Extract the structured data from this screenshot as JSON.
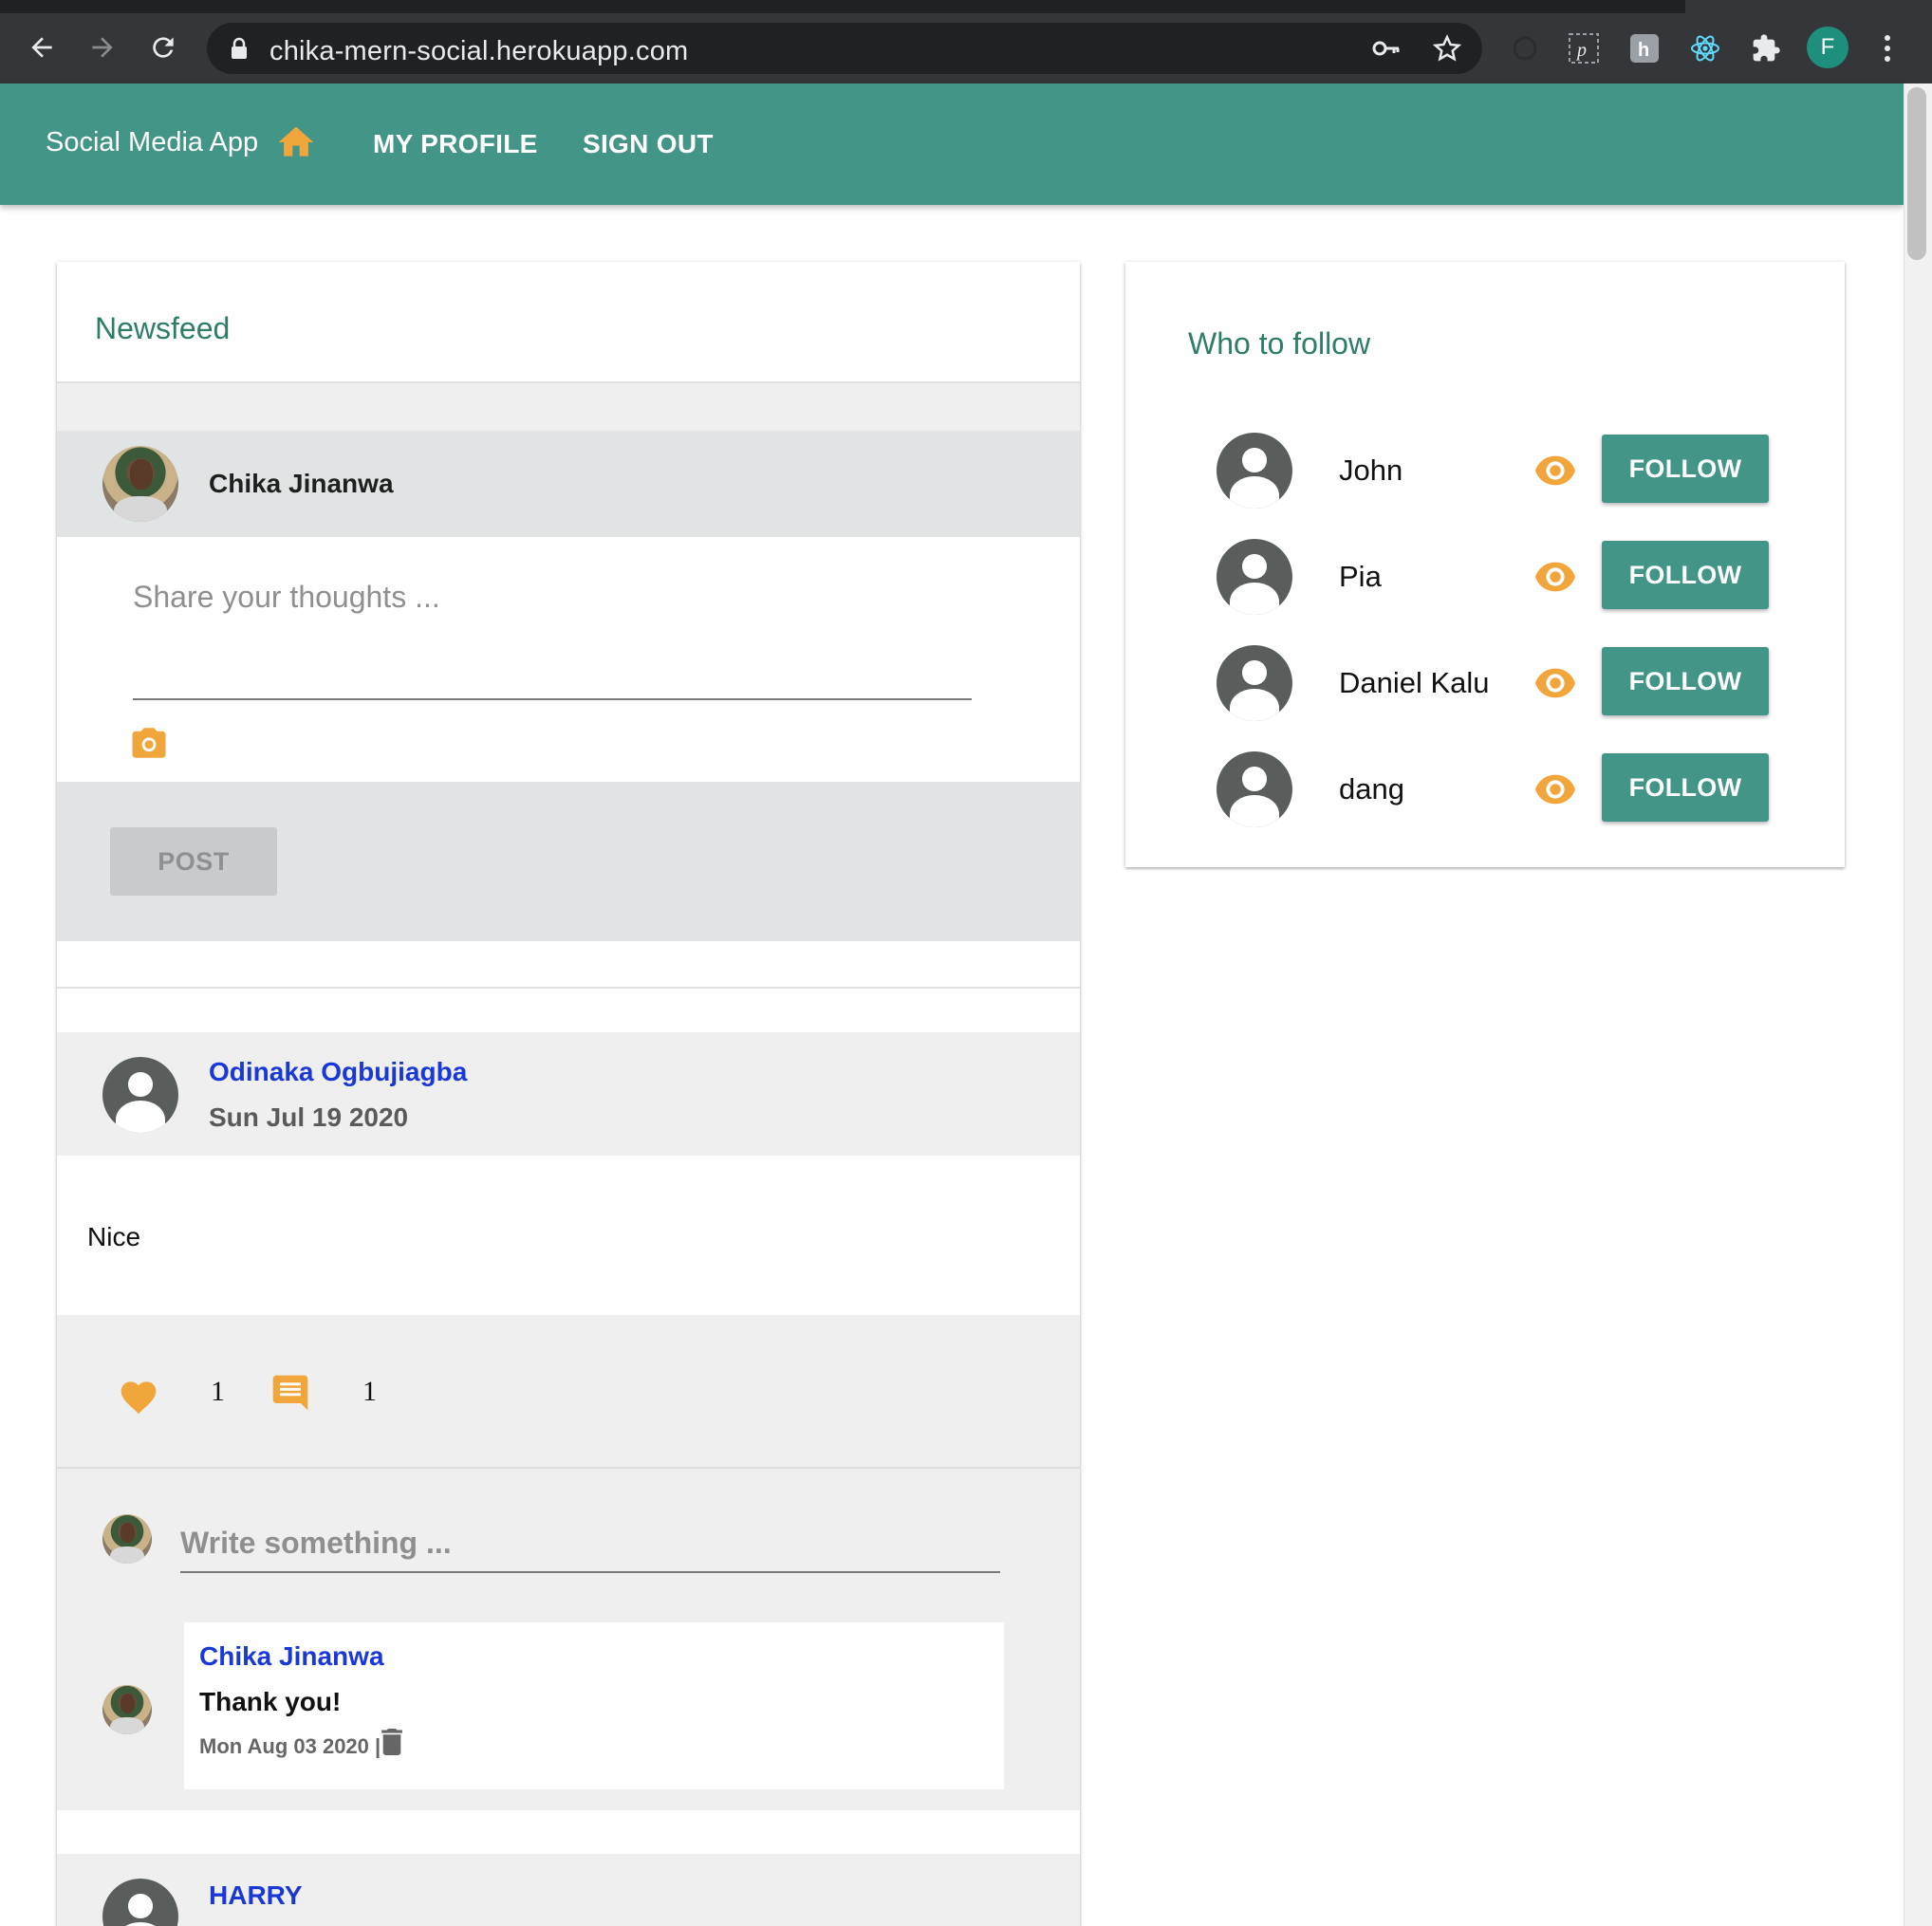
{
  "browser": {
    "url": "chika-mern-social.herokuapp.com",
    "profile_initial": "F"
  },
  "appbar": {
    "title": "Social Media App",
    "nav": [
      "MY PROFILE",
      "SIGN OUT"
    ]
  },
  "newsfeed": {
    "title": "Newsfeed",
    "new_post": {
      "user_name": "Chika Jinanwa",
      "placeholder": "Share your thoughts ...",
      "post_label": "POST"
    },
    "posts": [
      {
        "author": "Odinaka Ogbujiagba",
        "date": "Sun Jul 19 2020",
        "text": "Nice",
        "likes": "1",
        "comments_count": "1",
        "comment_placeholder": "Write something ...",
        "comments": [
          {
            "author": "Chika Jinanwa",
            "text": "Thank you!",
            "date": "Mon Aug 03 2020 |"
          }
        ]
      },
      {
        "author": "HARRY"
      }
    ]
  },
  "who_to_follow": {
    "title": "Who to follow",
    "users": [
      {
        "name": "John",
        "button": "FOLLOW"
      },
      {
        "name": "Pia",
        "button": "FOLLOW"
      },
      {
        "name": "Daniel Kalu",
        "button": "FOLLOW"
      },
      {
        "name": "dang",
        "button": "FOLLOW"
      }
    ]
  },
  "colors": {
    "primary": "#439587",
    "accent": "#f0a63b",
    "link": "#1a37d8"
  }
}
